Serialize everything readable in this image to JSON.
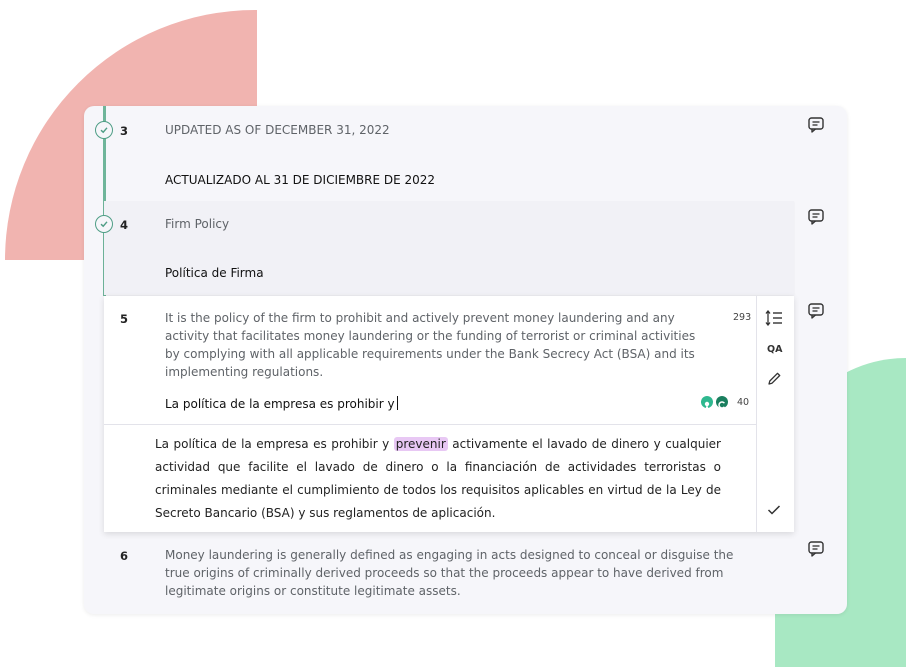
{
  "segments": [
    {
      "num": "3",
      "source": "UPDATED AS OF DECEMBER 31, 2022",
      "target": "ACTUALIZADO AL 31 DE DICIEMBRE DE 2022"
    },
    {
      "num": "4",
      "source": "Firm Policy",
      "target": "Política de Firma"
    },
    {
      "num": "5",
      "source": "It is the policy of the firm to prohibit and actively prevent money laundering and any activity that facilitates money laundering or the funding of terrorist or criminal activities by complying with all applicable requirements under the Bank Secrecy Act (BSA) and its implementing regulations.",
      "source_count": "293",
      "target": "La política de la empresa es prohibir y",
      "target_count": "40",
      "suggestion_before": "La política de la empresa es prohibir y",
      "suggestion_highlight": "prevenir",
      "suggestion_after": "activamente el lavado de dinero y cualquier actividad que facilite el lavado de dinero o la financiación de actividades terroristas o criminales mediante el cumplimiento de todos los requisitos aplicables en virtud de la Ley de Secreto Bancario (BSA) y sus reglamentos de aplicación."
    },
    {
      "num": "6",
      "source": "Money laundering is generally defined as engaging in acts designed to conceal or disguise the true origins of criminally derived proceeds so that the proceeds appear to have derived from legitimate origins or constitute legitimate assets."
    }
  ],
  "toolbar": {
    "qa_label": "QA"
  },
  "colors": {
    "accent_green": "#4f9e86",
    "highlight": "#e8c8f4",
    "pink": "#f1b4b0",
    "mint": "#a8e8c3"
  }
}
